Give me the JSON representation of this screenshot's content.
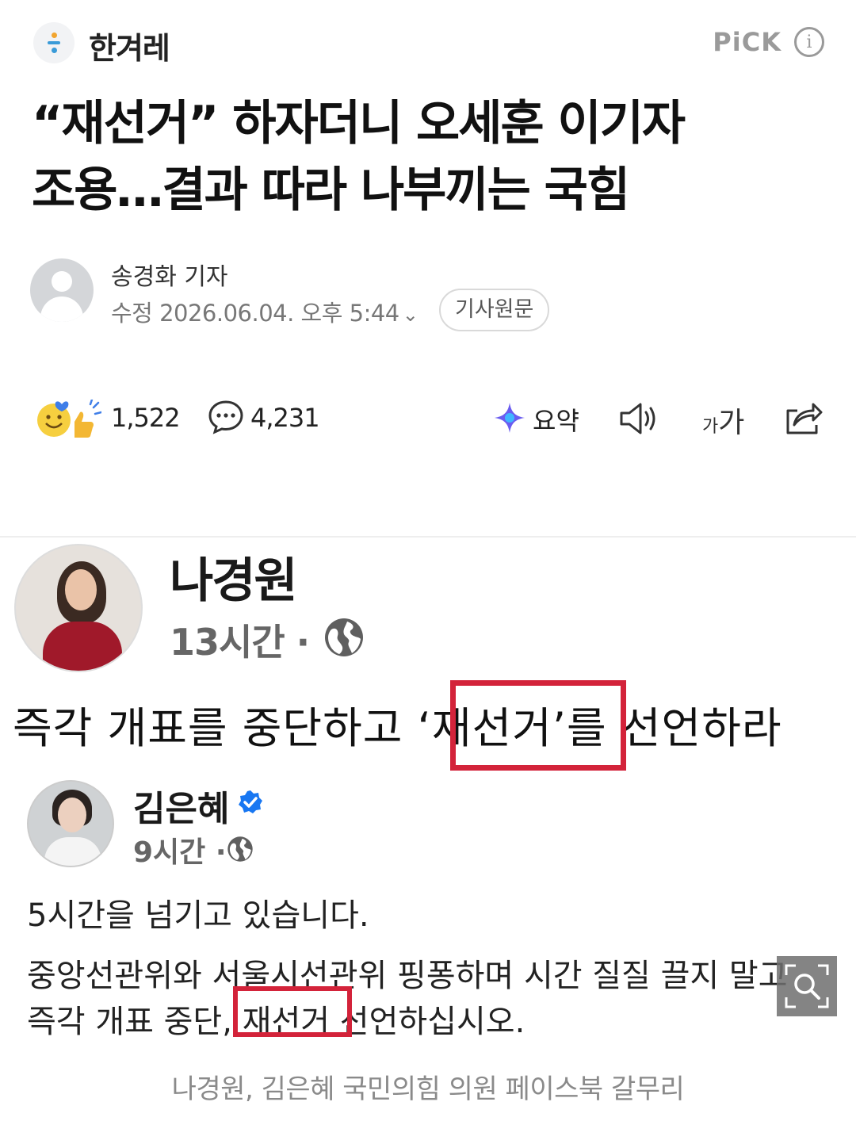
{
  "header": {
    "press_name": "한겨레",
    "pick_label": "PiCK",
    "info_icon": "i"
  },
  "article": {
    "headline_line1": "“재선거” 하자더니 오세훈 이기자",
    "headline_line2": "조용…결과 따라 나부끼는 국힘",
    "reporter": "송경화 기자",
    "modified": "수정 2026.06.04. 오후 5:44",
    "original_button": "기사원문"
  },
  "actions": {
    "reaction_count": "1,522",
    "comment_count": "4,231",
    "summary_label": "요약",
    "font_small": "가",
    "font_big": "가"
  },
  "photo": {
    "post1": {
      "name": "나경원",
      "time": "13시간 ·",
      "text_before": "즉각 개표를 중단하고 ",
      "text_highlight": "‘재선거’",
      "text_after": "를 선언하라"
    },
    "post2": {
      "name": "김은혜",
      "time": "9시간 ·",
      "line1": "5시간을 넘기고 있습니다.",
      "line2": "중앙선관위와 서울시선관위 핑퐁하며 시간 질질 끌지 말고",
      "line3_before": "즉각 개표 중단, ",
      "line3_highlight": "재선거",
      "line3_after": " 선언하십시오."
    },
    "caption": "나경원, 김은혜 국민의힘 의원 페이스북 갈무리"
  },
  "colors": {
    "highlight_red": "#d3233a",
    "verified_blue": "#1877f2"
  }
}
